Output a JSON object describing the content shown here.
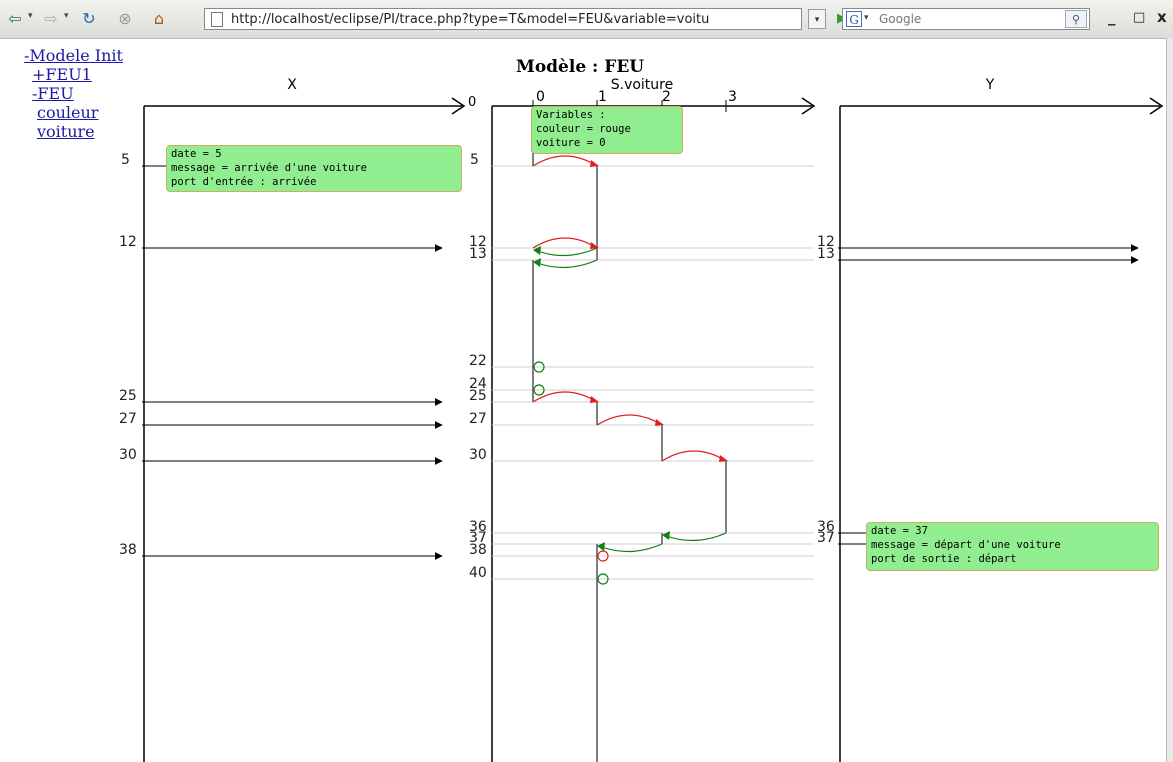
{
  "browser": {
    "url": "http://localhost/eclipse/PI/trace.php?type=T&model=FEU&variable=voitu",
    "search_engine": "G",
    "search_placeholder": "Google",
    "window_minimize": "_",
    "window_maximize": "□",
    "window_close": "x"
  },
  "tree": {
    "items": [
      "-Modele Init",
      "+FEU1",
      "-FEU",
      "couleur",
      "voiture"
    ]
  },
  "title": "Modèle : FEU",
  "lanes": {
    "x_label": "X",
    "middle_label": "S.voiture",
    "y_label": "Y",
    "middle_values": [
      "0",
      "1",
      "2",
      "3"
    ],
    "origin_label": "0"
  },
  "times": {
    "x_lane": [
      "5",
      "12",
      "25",
      "27",
      "30",
      "38"
    ],
    "middle": [
      "5",
      "12",
      "13",
      "22",
      "24",
      "25",
      "27",
      "30",
      "36",
      "37",
      "38",
      "40"
    ],
    "y_lane": [
      "12",
      "13",
      "36",
      "37"
    ]
  },
  "tooltips": {
    "variables": [
      "Variables :",
      "couleur = rouge",
      "voiture = 0"
    ],
    "input": [
      "date = 5",
      "message = arrivée d'une voiture",
      "port d'entrée : arrivée"
    ],
    "output": [
      "date = 37",
      "message = départ d'une voiture",
      "port de sortie : départ"
    ]
  },
  "colors": {
    "increment": "#e02020",
    "decrement": "#108010",
    "tooltip_bg": "#90ee90",
    "link": "#1a1aa6"
  }
}
